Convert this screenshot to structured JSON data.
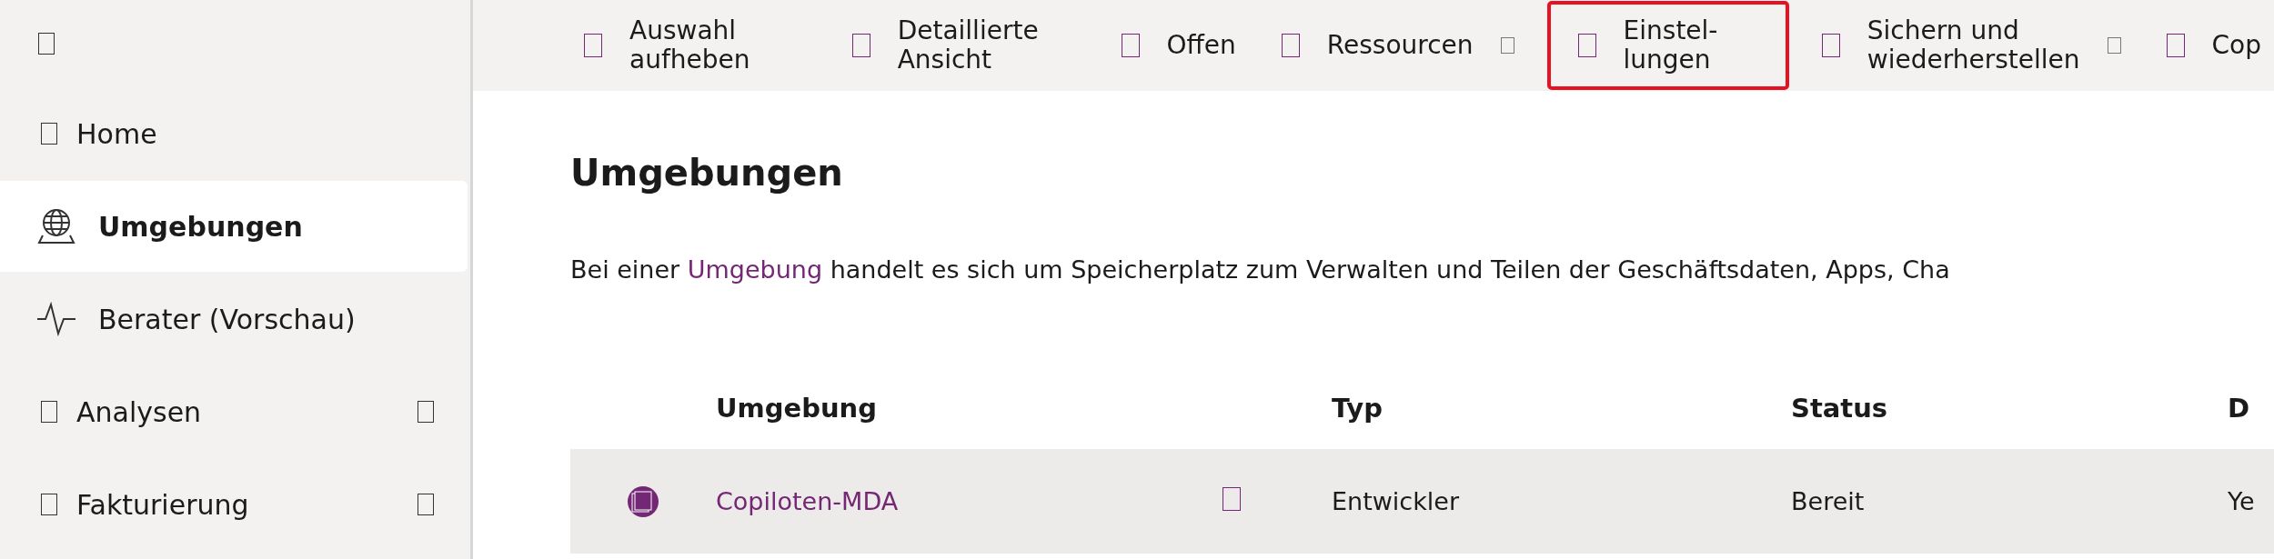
{
  "sidebar": {
    "items": [
      {
        "label": "Home",
        "kind": "placeholder",
        "selected": false,
        "expandable": false
      },
      {
        "label": "Umgebungen",
        "kind": "globe",
        "selected": true,
        "expandable": false
      },
      {
        "label": "Berater (Vorschau)",
        "kind": "pulse",
        "selected": false,
        "expandable": false
      },
      {
        "label": "Analysen",
        "kind": "placeholder",
        "selected": false,
        "expandable": true
      },
      {
        "label": "Fakturierung",
        "kind": "placeholder",
        "selected": false,
        "expandable": true
      }
    ]
  },
  "toolbar": [
    {
      "label": "Auswahl aufheben",
      "dropdown": false,
      "highlighted": false
    },
    {
      "label": "Detaillierte Ansicht",
      "dropdown": false,
      "highlighted": false
    },
    {
      "label": "Offen",
      "dropdown": false,
      "highlighted": false
    },
    {
      "label": "Ressourcen",
      "dropdown": true,
      "highlighted": false
    },
    {
      "label": "Einstel-lungen",
      "dropdown": false,
      "highlighted": true
    },
    {
      "label": "Sichern und wiederherstellen",
      "dropdown": true,
      "highlighted": false
    },
    {
      "label": "Cop",
      "dropdown": false,
      "highlighted": false
    }
  ],
  "page": {
    "title": "Umgebungen",
    "description": {
      "before": "Bei einer",
      "link": "Umgebung",
      "after": "handelt es sich um Speicherplatz zum Verwalten und Teilen der Geschäftsdaten, Apps, Cha"
    }
  },
  "table": {
    "columns": [
      "Umgebung",
      "Typ",
      "Status",
      "D"
    ],
    "rows": [
      {
        "name": "Copiloten-MDA",
        "type": "Entwickler",
        "status": "Bereit",
        "column_4": "Ye",
        "selected": true
      }
    ]
  }
}
